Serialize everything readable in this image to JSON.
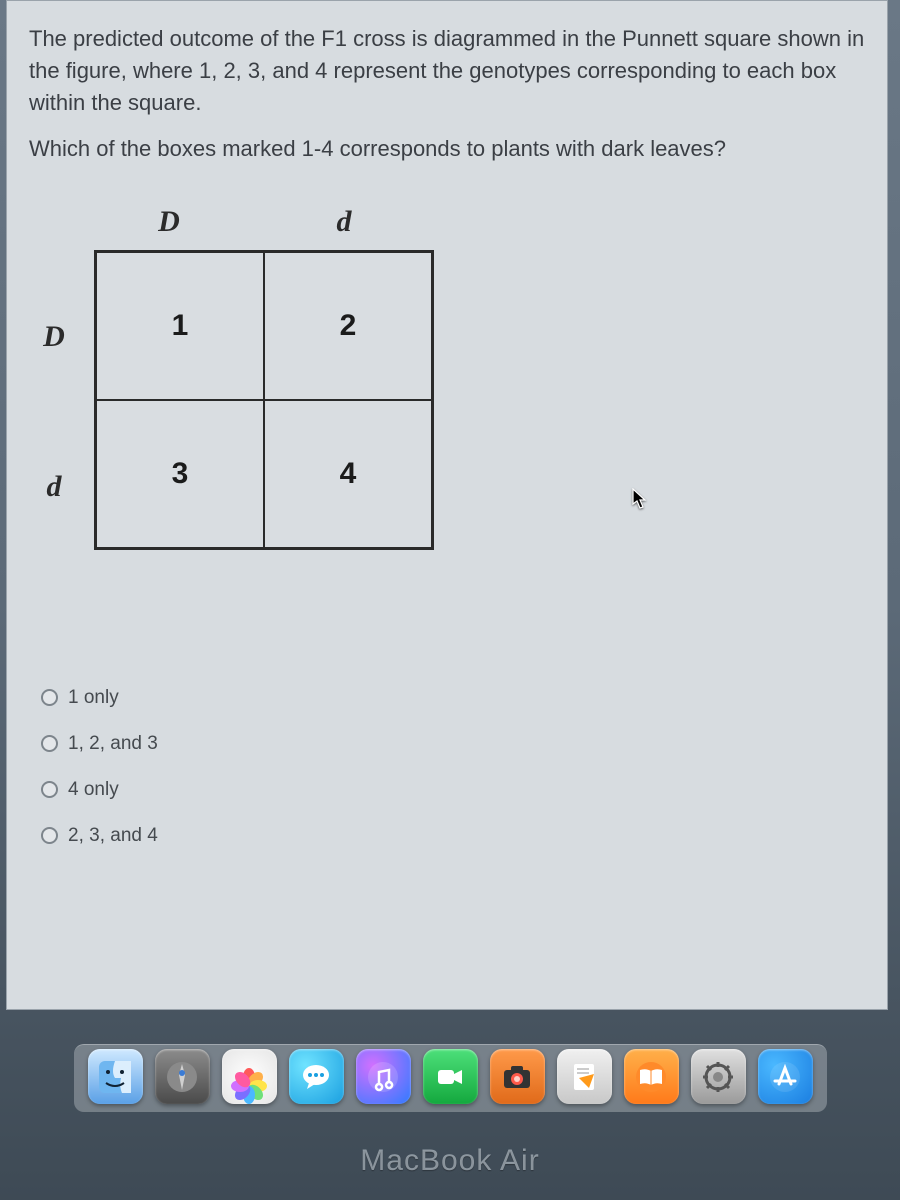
{
  "question": {
    "paragraph1": "The predicted outcome of the F1 cross is diagrammed in the Punnett square shown in the figure, where 1, 2, 3, and 4 represent the genotypes corresponding to each box within the square.",
    "paragraph2": "Which of the boxes marked 1-4 corresponds to plants with dark leaves?"
  },
  "punnett": {
    "col_labels": [
      "D",
      "d"
    ],
    "row_labels": [
      "D",
      "d"
    ],
    "cells": [
      "1",
      "2",
      "3",
      "4"
    ]
  },
  "options": [
    "1 only",
    "1, 2, and 3",
    "4 only",
    "2, 3, and 4"
  ],
  "dock": {
    "items": [
      "finder",
      "launchpad",
      "photos",
      "messages",
      "itunes",
      "facetime",
      "photobooth",
      "pages",
      "ibooks",
      "settings",
      "appstore"
    ]
  },
  "branding": "MacBook Air"
}
